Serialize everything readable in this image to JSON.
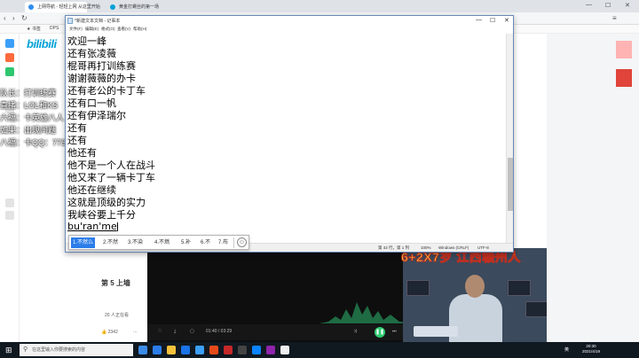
{
  "browser": {
    "tabs": [
      "上网导航 - 轻轻上网 从这里开始",
      "黄金打螺丝的第一场"
    ],
    "bookmarks": [
      "书签",
      "DPS"
    ],
    "logo": "bilibili"
  },
  "notepad": {
    "title": "*新建文本文档 - 记事本",
    "menu": [
      "文件(F)",
      "编辑(E)",
      "格式(O)",
      "查看(V)",
      "帮助(H)"
    ],
    "lines": [
      "欢迎一峰",
      "还有张凌薇",
      "棍哥再打训练赛",
      "谢谢薇薇的办卡",
      "还有老公的卡丁车",
      "还有口一帆",
      "还有伊泽瑞尔",
      "还有",
      "还有",
      "他还有",
      "他不是一个人在战斗",
      "他又来了一辆卡丁车",
      "他还在继续",
      "这就是顶级的实力",
      "我峡谷要上千分"
    ],
    "composing": "bu'ran'me",
    "status": {
      "position": "第 42 行，第 1 列",
      "zoom": "100%",
      "eol": "Windows (CRLF)",
      "encoding": "UTF-8"
    }
  },
  "ime": {
    "candidates": [
      "1.不然么",
      "2.不然",
      "3.不染",
      "4.不燃",
      "5.补",
      "6.不",
      "7.布"
    ]
  },
  "overlay": {
    "lines": [
      "队长：打训练赛",
      "直播：LOL和KS",
      "六福：卡英雄八人",
      "如果：出现问题",
      "八福：卡QQ：773665"
    ]
  },
  "video": {
    "title": "6+2X7岁 江西赣州人",
    "time": "01:40 / 03:29",
    "likes": "2342",
    "side_title": "第 5 上墙",
    "side_sub": "20 人正在看"
  },
  "taskbar": {
    "search": "在这里输入你要搜索的内容",
    "lang": "英",
    "time": "20:30",
    "date": "2021/4/19"
  }
}
